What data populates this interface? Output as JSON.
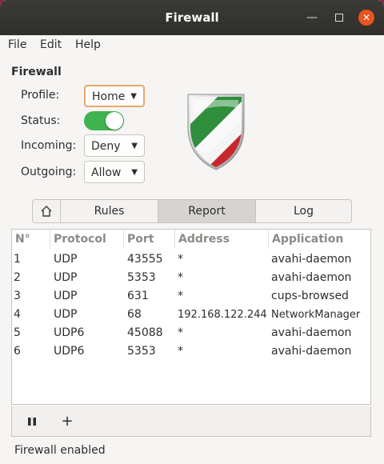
{
  "window": {
    "title": "Firewall"
  },
  "menubar": {
    "file": "File",
    "edit": "Edit",
    "help": "Help"
  },
  "section_title": "Firewall",
  "form": {
    "profile_label": "Profile:",
    "profile_value": "Home",
    "status_label": "Status:",
    "status_on": true,
    "incoming_label": "Incoming:",
    "incoming_value": "Deny",
    "outgoing_label": "Outgoing:",
    "outgoing_value": "Allow"
  },
  "tabs": {
    "rules": "Rules",
    "report": "Report",
    "log": "Log",
    "active": "Report"
  },
  "table": {
    "headers": [
      "N°",
      "Protocol",
      "Port",
      "Address",
      "Application"
    ],
    "rows": [
      [
        "1",
        "UDP",
        "43555",
        "*",
        "avahi-daemon"
      ],
      [
        "2",
        "UDP",
        "5353",
        "*",
        "avahi-daemon"
      ],
      [
        "3",
        "UDP",
        "631",
        "*",
        "cups-browsed"
      ],
      [
        "4",
        "UDP",
        "68",
        "192.168.122.244",
        "NetworkManager"
      ],
      [
        "5",
        "UDP6",
        "45088",
        "*",
        "avahi-daemon"
      ],
      [
        "6",
        "UDP6",
        "5353",
        "*",
        "avahi-daemon"
      ]
    ]
  },
  "toolbar": {
    "pause_icon": "pause-icon",
    "add_icon": "plus-icon"
  },
  "status_text": "Firewall enabled",
  "colors": {
    "accent_green": "#3eb34f",
    "close_orange": "#e9541f",
    "titlebar": "#33322e"
  }
}
